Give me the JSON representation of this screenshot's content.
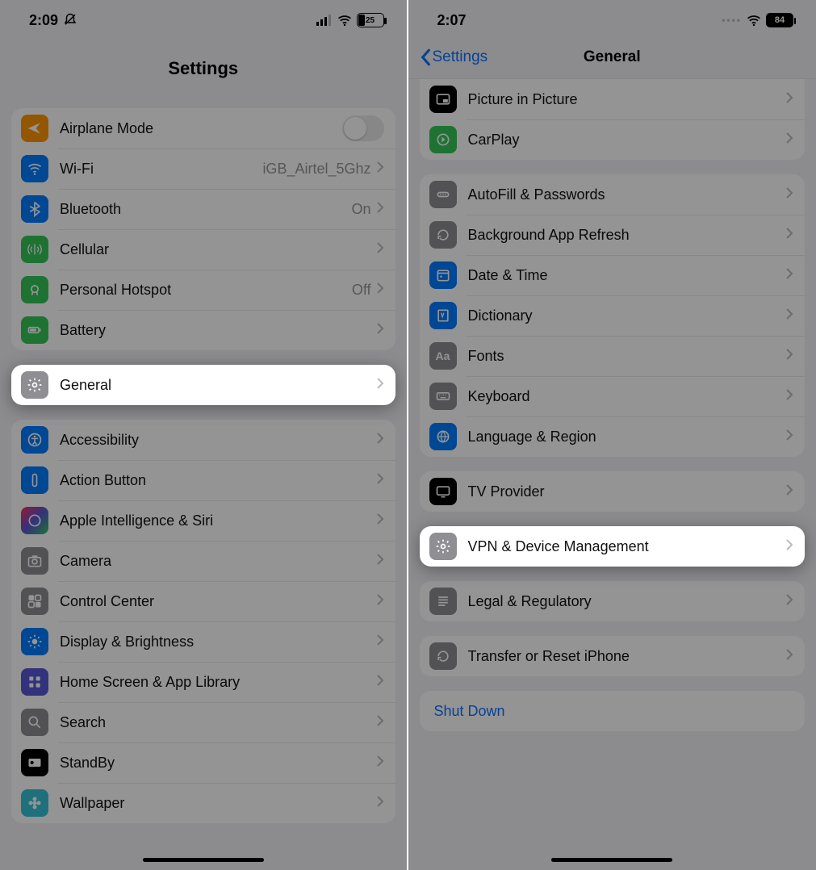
{
  "left": {
    "status": {
      "time": "2:09",
      "battery": "25"
    },
    "title": "Settings",
    "groups": [
      [
        {
          "icon": "airplane-icon",
          "color": "#ff9500",
          "label": "Airplane Mode",
          "ctrl": "toggle"
        },
        {
          "icon": "wifi-icon",
          "color": "#007aff",
          "label": "Wi-Fi",
          "value": "iGB_Airtel_5Ghz"
        },
        {
          "icon": "bluetooth-icon",
          "color": "#007aff",
          "label": "Bluetooth",
          "value": "On"
        },
        {
          "icon": "cellular-icon",
          "color": "#34c759",
          "label": "Cellular"
        },
        {
          "icon": "hotspot-icon",
          "color": "#34c759",
          "label": "Personal Hotspot",
          "value": "Off"
        },
        {
          "icon": "battery-icon",
          "color": "#34c759",
          "label": "Battery"
        }
      ],
      "HIGHLIGHT_GENERAL",
      [
        {
          "icon": "accessibility-icon",
          "color": "#007aff",
          "label": "Accessibility"
        },
        {
          "icon": "action-icon",
          "color": "#007aff",
          "label": "Action Button"
        },
        {
          "icon": "ai-icon",
          "color": "grad",
          "label": "Apple Intelligence & Siri"
        },
        {
          "icon": "camera-icon",
          "color": "#8e8e93",
          "label": "Camera"
        },
        {
          "icon": "control-icon",
          "color": "#8e8e93",
          "label": "Control Center"
        },
        {
          "icon": "display-icon",
          "color": "#007aff",
          "label": "Display & Brightness"
        },
        {
          "icon": "home-icon",
          "color": "#5856d6",
          "label": "Home Screen & App Library"
        },
        {
          "icon": "search-icon",
          "color": "#8e8e93",
          "label": "Search"
        },
        {
          "icon": "standby-icon",
          "color": "#000000",
          "label": "StandBy"
        },
        {
          "icon": "wallpaper-icon",
          "color": "#34c3d6",
          "label": "Wallpaper"
        }
      ]
    ],
    "highlight": {
      "icon": "gear-icon",
      "color": "#8e8e93",
      "label": "General"
    }
  },
  "right": {
    "status": {
      "time": "2:07",
      "battery": "84"
    },
    "back": "Settings",
    "title": "General",
    "groups_top": [
      {
        "icon": "pip-icon",
        "color": "#000000",
        "label": "Picture in Picture"
      },
      {
        "icon": "carplay-icon",
        "color": "#34c759",
        "label": "CarPlay"
      }
    ],
    "groups_mid": [
      {
        "icon": "autofill-icon",
        "color": "#8e8e93",
        "label": "AutoFill & Passwords"
      },
      {
        "icon": "refresh-icon",
        "color": "#8e8e93",
        "label": "Background App Refresh"
      },
      {
        "icon": "date-icon",
        "color": "#007aff",
        "label": "Date & Time"
      },
      {
        "icon": "dictionary-icon",
        "color": "#007aff",
        "label": "Dictionary"
      },
      {
        "icon": "fonts-icon",
        "color": "#8e8e93",
        "label": "Fonts"
      },
      {
        "icon": "keyboard-icon",
        "color": "#8e8e93",
        "label": "Keyboard"
      },
      {
        "icon": "language-icon",
        "color": "#007aff",
        "label": "Language & Region"
      }
    ],
    "group_tv": [
      {
        "icon": "tv-icon",
        "color": "#000000",
        "label": "TV Provider"
      }
    ],
    "highlight": {
      "icon": "gear-icon",
      "color": "#8e8e93",
      "label": "VPN & Device Management"
    },
    "group_legal": [
      {
        "icon": "legal-icon",
        "color": "#8e8e93",
        "label": "Legal & Regulatory"
      }
    ],
    "group_reset": [
      {
        "icon": "reset-icon",
        "color": "#8e8e93",
        "label": "Transfer or Reset iPhone"
      }
    ],
    "shutdown": "Shut Down"
  },
  "glyphs": {
    "airplane-icon": "✈",
    "wifi-icon": "wifi",
    "bluetooth-icon": "bt",
    "cellular-icon": "ant",
    "hotspot-icon": "link",
    "battery-icon": "bat",
    "gear-icon": "gear",
    "accessibility-icon": "acc",
    "action-icon": "act",
    "ai-icon": "ai",
    "camera-icon": "cam",
    "control-icon": "cc",
    "display-icon": "sun",
    "home-icon": "grid",
    "search-icon": "mag",
    "standby-icon": "sb",
    "wallpaper-icon": "flower",
    "pip-icon": "pip",
    "carplay-icon": "cp",
    "autofill-icon": "dots",
    "refresh-icon": "ref",
    "date-icon": "cal",
    "dictionary-icon": "book",
    "fonts-icon": "Aa",
    "keyboard-icon": "kb",
    "language-icon": "globe",
    "tv-icon": "tv",
    "legal-icon": "lines",
    "reset-icon": "reset"
  }
}
